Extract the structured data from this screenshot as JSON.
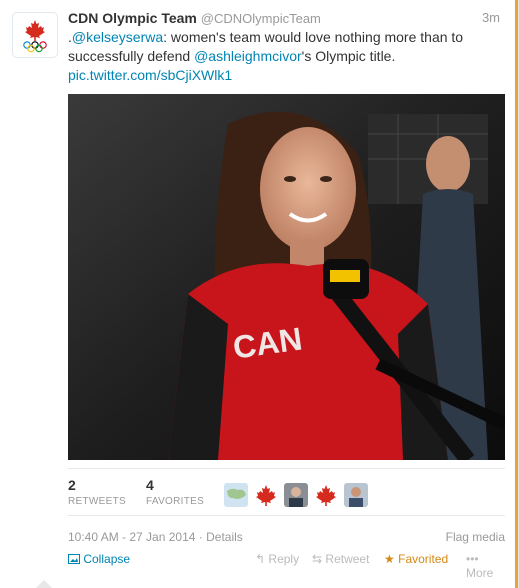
{
  "tweet": {
    "fullname": "CDN Olympic Team",
    "username": "@CDNOlympicTeam",
    "time": "3m",
    "text_parts": {
      "p1": ".",
      "mention1": "@kelseyserwa",
      "p2": ": women's team would love nothing more than to successfully defend ",
      "mention2": "@ashleighmcivor",
      "p3": "'s Olympic title.",
      "link": "pic.twitter.com/sbCjiXWlk1"
    }
  },
  "stats": {
    "retweets_count": "2",
    "retweets_label": "RETWEETS",
    "favorites_count": "4",
    "favorites_label": "FAVORITES"
  },
  "meta": {
    "timestamp": "10:40 AM - 27 Jan 2014",
    "separator": "·",
    "details": "Details",
    "flag_media": "Flag media"
  },
  "actions": {
    "collapse": "Collapse",
    "reply": "Reply",
    "retweet": "Retweet",
    "favorited": "Favorited",
    "more": "More"
  },
  "colors": {
    "link": "#0084b4",
    "favorited": "#d58915",
    "accent": "#e6a23c",
    "canada_red": "#d52b1e"
  }
}
